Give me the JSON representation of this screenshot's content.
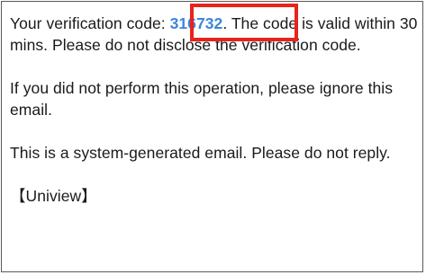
{
  "email": {
    "code_prefix": "Your verification code: ",
    "code": "316732",
    "code_suffix": ". The code is valid within 30 mins. Please do not disclose the verification code.",
    "paragraph_ignore": "If you did not perform this operation, please ignore this email.",
    "paragraph_system": "This is a system-generated email. Please do not reply.",
    "signature": "【Uniview】"
  },
  "colors": {
    "code": "#3a86d9",
    "highlight": "#e8231b",
    "frame_border": "#5a5a5a"
  }
}
